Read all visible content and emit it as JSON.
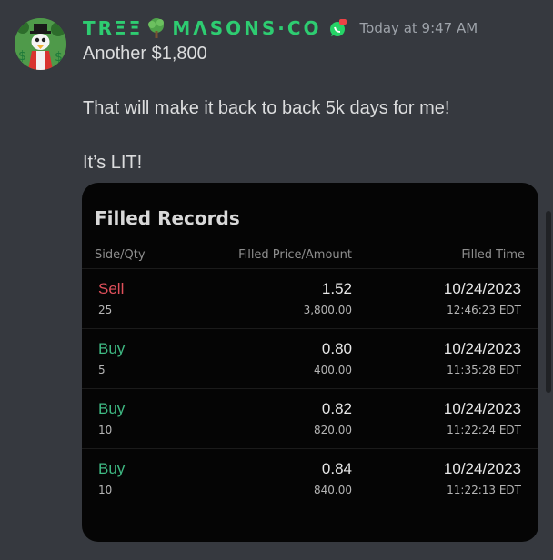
{
  "author": {
    "name_part1": "TRΞΞ",
    "name_part2": "MΛSONS·CO",
    "avatar_icon": "scrooge-avatar-icon",
    "tree_icon": "tree-icon",
    "badge_icon": "whatsapp-badge-icon",
    "brand_color": "#2ecc71"
  },
  "timestamp": "Today at 9:47 AM",
  "messages": [
    "Another $1,800",
    "That will make it back to back 5k days for me!",
    "It’s LIT!"
  ],
  "card": {
    "title": "Filled Records",
    "columns": {
      "side_qty": "Side/Qty",
      "price_amount": "Filled Price/Amount",
      "time": "Filled Time"
    },
    "records": [
      {
        "side": "Sell",
        "qty": "25",
        "price": "1.52",
        "amount": "3,800.00",
        "date": "10/24/2023",
        "time": "12:46:23 EDT"
      },
      {
        "side": "Buy",
        "qty": "5",
        "price": "0.80",
        "amount": "400.00",
        "date": "10/24/2023",
        "time": "11:35:28 EDT"
      },
      {
        "side": "Buy",
        "qty": "10",
        "price": "0.82",
        "amount": "820.00",
        "date": "10/24/2023",
        "time": "11:22:24 EDT"
      },
      {
        "side": "Buy",
        "qty": "10",
        "price": "0.84",
        "amount": "840.00",
        "date": "10/24/2023",
        "time": "11:22:13 EDT"
      }
    ],
    "sell_color": "#e0505b",
    "buy_color": "#3fb983"
  }
}
